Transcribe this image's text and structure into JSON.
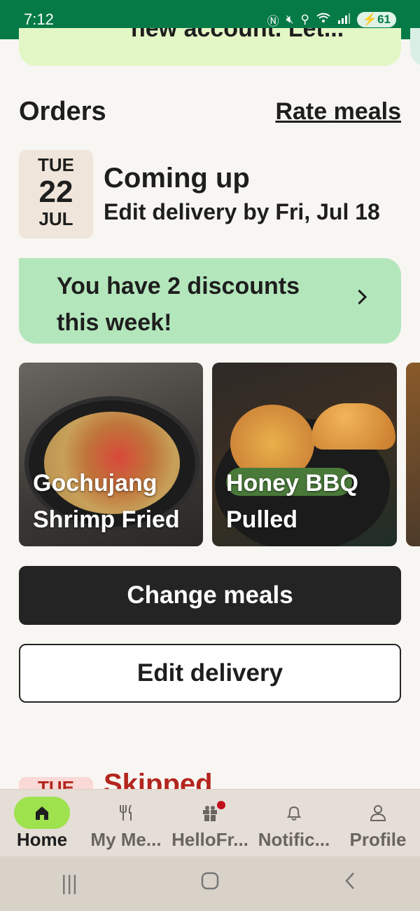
{
  "status_bar": {
    "time": "7:12",
    "icons": [
      "nfc-icon",
      "mute-icon",
      "location-icon",
      "wifi-icon",
      "signal-icon"
    ],
    "battery": "61"
  },
  "promo_top": {
    "text": "new account. Let..."
  },
  "orders": {
    "title": "Orders",
    "rate_link": "Rate meals"
  },
  "upcoming": {
    "date": {
      "dow": "TUE",
      "day": "22",
      "month": "JUL"
    },
    "title": "Coming up",
    "subtitle": "Edit delivery by Fri, Jul 18",
    "discount_banner": "You have 2 discounts this week!",
    "meals": [
      {
        "name": "Gochujang Shrimp Fried"
      },
      {
        "name": "Honey BBQ Pulled"
      }
    ],
    "change_button": "Change meals",
    "edit_button": "Edit delivery"
  },
  "skipped": {
    "date_dow": "TUE",
    "title": "Skipped"
  },
  "bottom_nav": {
    "items": [
      {
        "label": "Home",
        "icon": "home-icon",
        "active": true
      },
      {
        "label": "My Me...",
        "icon": "fork-knife-icon",
        "active": false
      },
      {
        "label": "HelloFr...",
        "icon": "gift-icon",
        "active": false
      },
      {
        "label": "Notific...",
        "icon": "bell-icon",
        "active": false
      },
      {
        "label": "Profile",
        "icon": "person-icon",
        "active": false
      }
    ]
  },
  "colors": {
    "status_bar": "#067a46",
    "nav_active": "#9ee24e",
    "discount_banner": "#b4e6bc",
    "skipped": "#b3261e"
  }
}
